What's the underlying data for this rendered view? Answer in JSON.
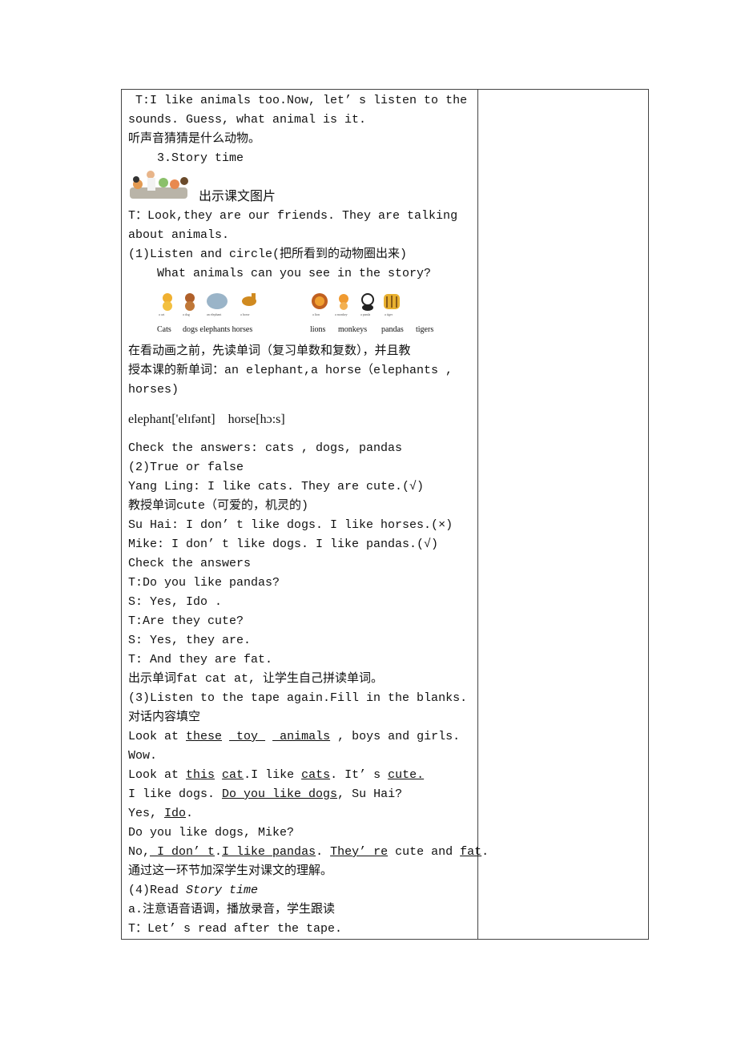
{
  "part1": [
    [
      {
        "t": " T:I like animals too.Now, let’ s listen to the"
      }
    ],
    [
      {
        "t": "sounds. Guess, what animal is it."
      }
    ],
    [
      {
        "t": "听声音猜猜是什么动物。"
      }
    ],
    [
      {
        "t": "    3.Story time"
      }
    ]
  ],
  "picture_caption": "出示课文图片",
  "part2": [
    [
      {
        "t": "T：Look,they are our friends. They are talking"
      }
    ],
    [
      {
        "t": "about animals."
      }
    ],
    [
      {
        "t": "(1)Listen and circle(把所看到的动物圈出来)"
      }
    ],
    [
      {
        "t": "    What animals can you see in the story?"
      }
    ]
  ],
  "animals": {
    "tiny": [
      "a cat",
      "a dog",
      "an elephant",
      "a horse",
      "a lion",
      "a monkey",
      "a panda",
      "a tiger"
    ],
    "labels": [
      "Cats",
      "dogs elephants horses",
      "lions",
      "monkeys",
      "pandas",
      "tigers"
    ]
  },
  "part3": [
    [
      {
        "t": "在看动画之前，先读单词（复习单数和复数），并且教"
      }
    ],
    [
      {
        "t": "授本课的新单词：an elephant,a horse（elephants ,"
      }
    ],
    [
      {
        "t": "horses)"
      }
    ]
  ],
  "phonetics": "elephant['elɪfənt]    horse[hɔ:s]",
  "part4": [
    [
      {
        "t": "Check the answers: cats , dogs, pandas"
      }
    ],
    [
      {
        "t": "(2)True or false"
      }
    ],
    [
      {
        "t": "Yang Ling: I like cats. They are cute.(√)"
      }
    ],
    [
      {
        "t": "教授单词cute（可爱的，机灵的)"
      }
    ],
    [
      {
        "t": "Su Hai: I don’ t like dogs. I like horses.(×)"
      }
    ],
    [
      {
        "t": "Mike: I don’ t like dogs. I like pandas.(√)"
      }
    ],
    [
      {
        "t": "Check the answers"
      }
    ],
    [
      {
        "t": "T:Do you like pandas?"
      }
    ],
    [
      {
        "t": "S: Yes, Ido ."
      }
    ],
    [
      {
        "t": "T:Are they cute?"
      }
    ],
    [
      {
        "t": "S: Yes, they are."
      }
    ],
    [
      {
        "t": "T: And they are fat."
      }
    ],
    [
      {
        "t": "出示单词fat cat at, 让学生自己拼读单词。"
      }
    ],
    [
      {
        "t": "(3)Listen to the tape again.Fill in the blanks."
      }
    ],
    [
      {
        "t": "对话内容填空"
      }
    ],
    [
      {
        "t": "Look at "
      },
      {
        "t": "these",
        "u": true
      },
      {
        "t": " "
      },
      {
        "t": " toy ",
        "u": true
      },
      {
        "t": " "
      },
      {
        "t": " animals",
        "u": true
      },
      {
        "t": " , boys and girls."
      }
    ],
    [
      {
        "t": "Wow."
      }
    ],
    [
      {
        "t": "Look at "
      },
      {
        "t": "this",
        "u": true
      },
      {
        "t": " "
      },
      {
        "t": "cat",
        "u": true
      },
      {
        "t": ".I like "
      },
      {
        "t": "cats",
        "u": true
      },
      {
        "t": ". It’ s "
      },
      {
        "t": "cute.",
        "u": true
      }
    ],
    [
      {
        "t": "I like dogs. "
      },
      {
        "t": "Do you like dogs",
        "u": true
      },
      {
        "t": ", Su Hai?"
      }
    ],
    [
      {
        "t": "Yes, "
      },
      {
        "t": "Ido",
        "u": true
      },
      {
        "t": "."
      }
    ],
    [
      {
        "t": "Do you like dogs, Mike?"
      }
    ],
    [
      {
        "t": "No,"
      },
      {
        "t": " I don’ t",
        "u": true
      },
      {
        "t": "."
      },
      {
        "t": "I like pandas",
        "u": true
      },
      {
        "t": ". "
      },
      {
        "t": "They’ re",
        "u": true
      },
      {
        "t": " cute and "
      },
      {
        "t": "fat",
        "u": true
      },
      {
        "t": "."
      }
    ],
    [
      {
        "t": "通过这一环节加深学生对课文的理解。"
      }
    ],
    [
      {
        "t": "(4)Read "
      },
      {
        "t": "Story time",
        "i": true
      }
    ],
    [
      {
        "t": "a.注意语音语调，播放录音，学生跟读"
      }
    ],
    [
      {
        "t": "T：Let’ s read after the tape."
      }
    ]
  ]
}
